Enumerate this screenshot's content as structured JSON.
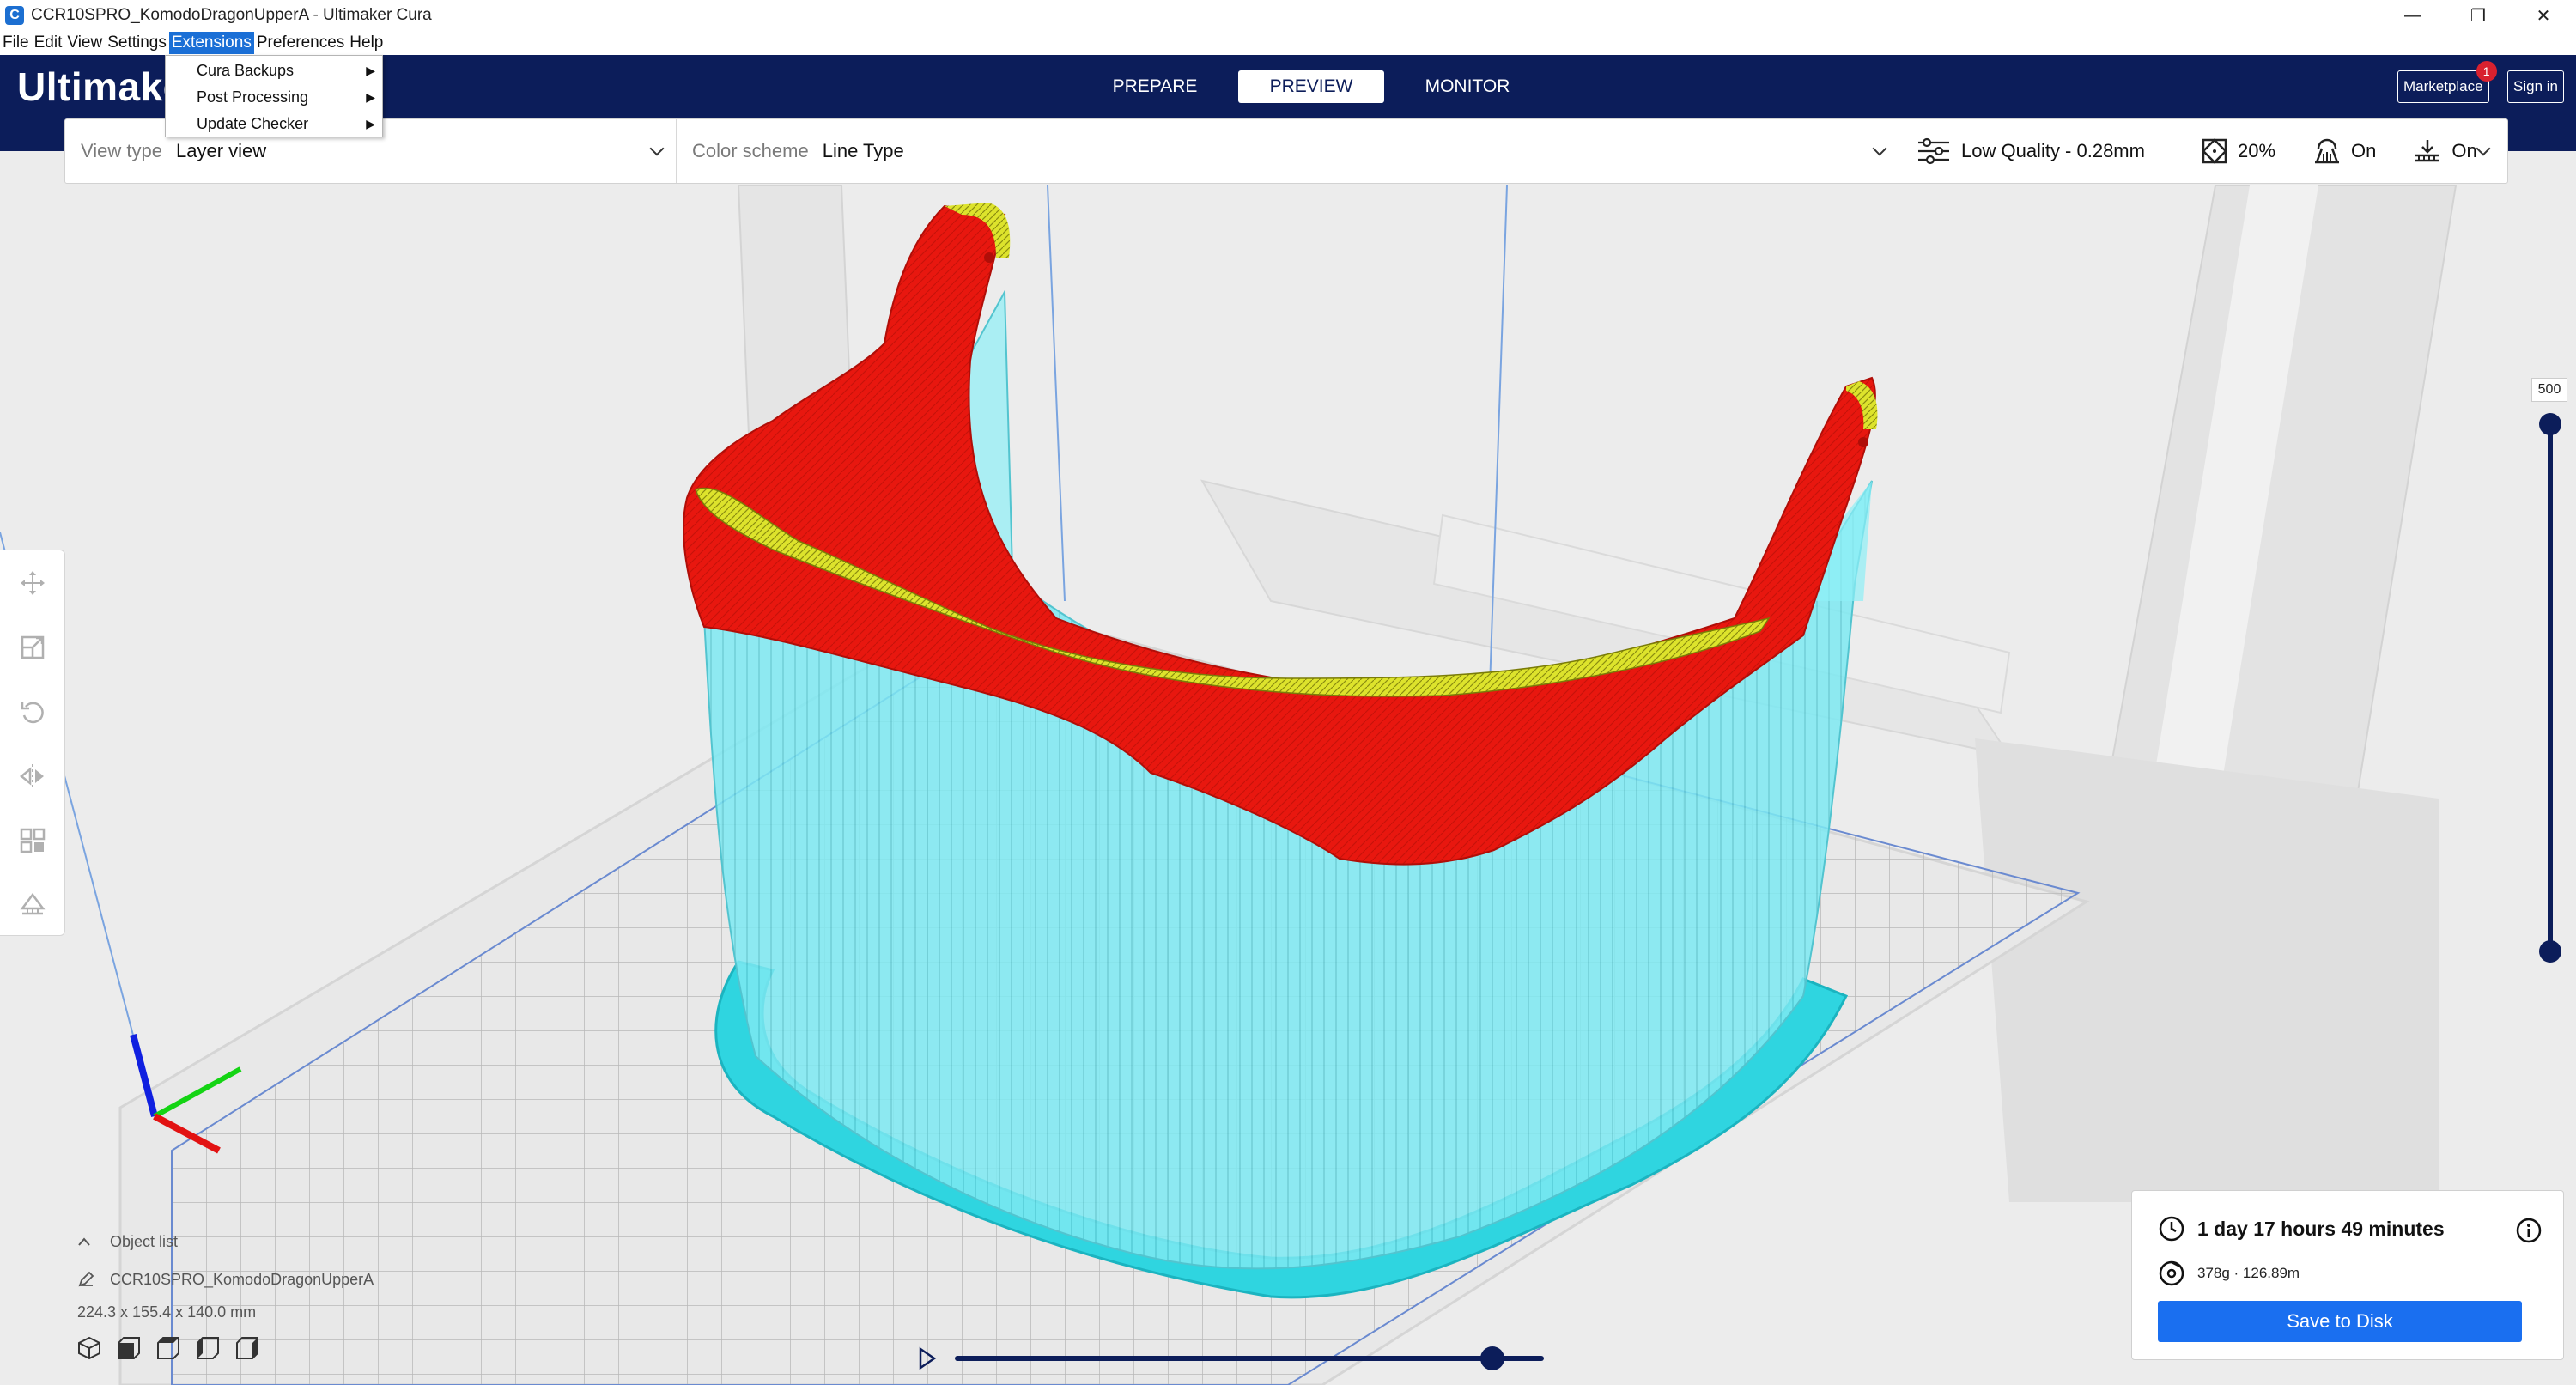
{
  "window": {
    "title": "CCR10SPRO_KomodoDragonUpperA - Ultimaker Cura",
    "app_icon_glyph": "C",
    "minimize": "—",
    "maximize": "❐",
    "close": "✕"
  },
  "menubar": {
    "items": [
      "File",
      "Edit",
      "View",
      "Settings",
      "Extensions",
      "Preferences",
      "Help"
    ],
    "active_index": 4
  },
  "extensions_menu": {
    "items": [
      {
        "label": "Cura Backups",
        "submenu": "▶"
      },
      {
        "label": "Post Processing",
        "submenu": "▶"
      },
      {
        "label": "Update Checker",
        "submenu": "▶"
      }
    ]
  },
  "header": {
    "logo_text": "Ultimaker",
    "tabs": [
      "PREPARE",
      "PREVIEW",
      "MONITOR"
    ],
    "active_tab": 1,
    "marketplace_label": "Marketplace",
    "marketplace_badge": "1",
    "sign_in_label": "Sign in"
  },
  "toolbar": {
    "view_type_label": "View type",
    "view_type_value": "Layer view",
    "color_scheme_label": "Color scheme",
    "color_scheme_value": "Line Type",
    "quality": "Low Quality - 0.28mm",
    "infill": "20%",
    "support": "On",
    "adhesion": "On"
  },
  "tools": [
    "move-icon",
    "scale-icon",
    "rotate-icon",
    "mirror-icon",
    "per-model-settings-icon",
    "support-blocker-icon"
  ],
  "layer_slider": {
    "max_layer": "500",
    "upper_fraction": 1.0,
    "lower_fraction": 0.0
  },
  "object_list": {
    "header": "Object list",
    "object_name": "CCR10SPRO_KomodoDragonUpperA",
    "dimensions": "224.3 x 155.4 x 140.0 mm"
  },
  "playback": {
    "progress_fraction": 1.0
  },
  "print_info": {
    "time": "1 day 17 hours 49 minutes",
    "material": "378g · 126.89m",
    "save_label": "Save to Disk"
  },
  "colors": {
    "header_bg": "#0c1d5a",
    "accent_blue": "#1a6ff0",
    "wall_red": "#e8170f",
    "skin_yellow": "#d9e12a",
    "support_cyan": "#6fe6f0",
    "skirt_cyan": "#2fd5e0"
  }
}
